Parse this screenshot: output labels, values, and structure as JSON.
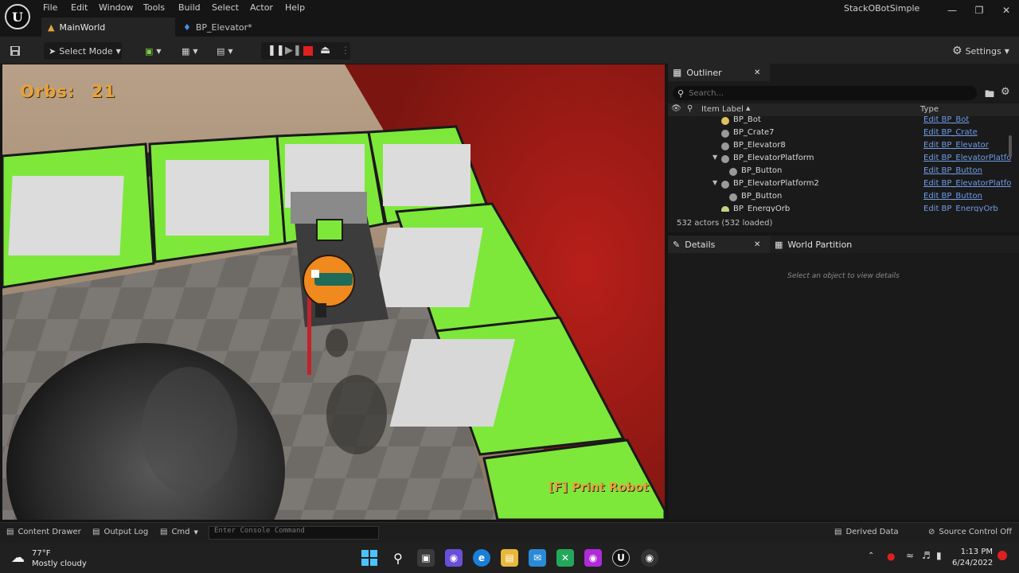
{
  "menu": {
    "items": [
      "File",
      "Edit",
      "Window",
      "Tools",
      "Build",
      "Select",
      "Actor",
      "Help"
    ]
  },
  "project_title": "StackOBotSimple",
  "tabs": [
    {
      "label": "MainWorld"
    },
    {
      "label": "BP_Elevator*"
    }
  ],
  "toolbar": {
    "select_mode_label": "Select Mode",
    "settings_label": "Settings"
  },
  "viewport": {
    "orbs_label": "Orbs:",
    "orbs_count": "21",
    "hint_label": "[F] Print Robot"
  },
  "outliner": {
    "title": "Outliner",
    "search_placeholder": "Search...",
    "col_item_label": "Item Label",
    "col_type": "Type",
    "rows": [
      {
        "label": "BP_Bot",
        "type": "Edit BP_Bot",
        "indent": 1
      },
      {
        "label": "BP_Crate7",
        "type": "Edit BP_Crate",
        "indent": 1
      },
      {
        "label": "BP_Elevator8",
        "type": "Edit BP_Elevator",
        "indent": 1
      },
      {
        "label": "BP_ElevatorPlatform",
        "type": "Edit BP_ElevatorPlatfor",
        "indent": 1,
        "expanded": true
      },
      {
        "label": "BP_Button",
        "type": "Edit BP_Button",
        "indent": 2
      },
      {
        "label": "BP_ElevatorPlatform2",
        "type": "Edit BP_ElevatorPlatfor",
        "indent": 1,
        "expanded": true
      },
      {
        "label": "BP_Button",
        "type": "Edit BP_Button",
        "indent": 2
      },
      {
        "label": "BP_EnergyOrb",
        "type": "Edit BP_EnergyOrb",
        "indent": 1
      }
    ],
    "actor_count": "532 actors (532 loaded)"
  },
  "details": {
    "tab_details": "Details",
    "tab_world_partition": "World Partition",
    "empty_message": "Select an object to view details"
  },
  "statusbar": {
    "content_drawer": "Content Drawer",
    "output_log": "Output Log",
    "cmd": "Cmd",
    "console_placeholder": "Enter Console Command",
    "derived_data": "Derived Data",
    "source_control": "Source Control Off"
  },
  "taskbar": {
    "weather_temp": "77°F",
    "weather_desc": "Mostly cloudy",
    "time": "1:13 PM",
    "date": "6/24/2022"
  },
  "colors": {
    "accent": "#e8a23a",
    "link": "#6f9de8",
    "green_platform": "#7de83a"
  }
}
